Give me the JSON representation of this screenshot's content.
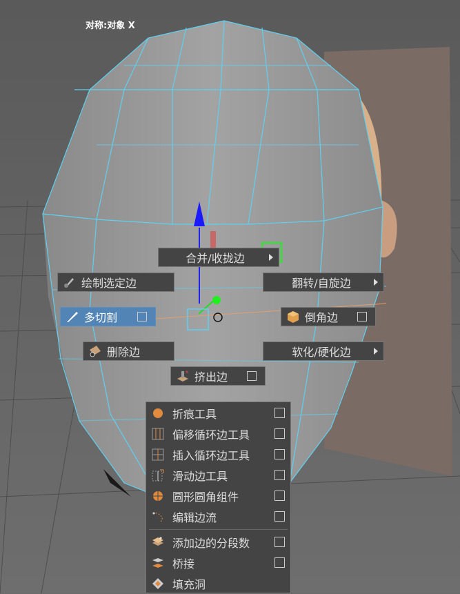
{
  "viewport": {
    "object_label": "对称:对象 X"
  },
  "marking_menu": {
    "merge": {
      "label": "合并/收拢边",
      "icon": "submenu-arrow-icon"
    },
    "paint_select": {
      "label": "绘制选定边",
      "icon": "paint-brush-icon"
    },
    "flip_spin": {
      "label": "翻转/自旋边",
      "icon": "submenu-arrow-icon"
    },
    "multi_cut": {
      "label": "多切割",
      "icon": "knife-icon"
    },
    "bevel": {
      "label": "倒角边",
      "icon": "bevel-cube-icon"
    },
    "delete": {
      "label": "删除边",
      "icon": "delete-edge-icon"
    },
    "soften_harden": {
      "label": "软化/硬化边",
      "icon": "submenu-arrow-icon"
    },
    "extrude": {
      "label": "挤出边",
      "icon": "extrude-icon"
    }
  },
  "submenu": {
    "items": [
      {
        "label": "折痕工具",
        "icon": "crease-icon"
      },
      {
        "label": "偏移循环边工具",
        "icon": "offset-loop-icon"
      },
      {
        "label": "插入循环边工具",
        "icon": "insert-loop-icon"
      },
      {
        "label": "滑动边工具",
        "icon": "slide-edge-icon"
      },
      {
        "label": "圆形圆角组件",
        "icon": "circularize-icon"
      },
      {
        "label": "编辑边流",
        "icon": "edge-flow-icon"
      },
      {
        "label": "添加边的分段数",
        "icon": "add-divisions-icon"
      },
      {
        "label": "桥接",
        "icon": "bridge-icon"
      },
      {
        "label": "填充洞",
        "icon": "fill-hole-icon"
      }
    ]
  },
  "colors": {
    "menu_bg": "#444444",
    "highlight": "#5285b6",
    "wireframe": "#5fd0f0",
    "background": "#6b6b6b"
  }
}
